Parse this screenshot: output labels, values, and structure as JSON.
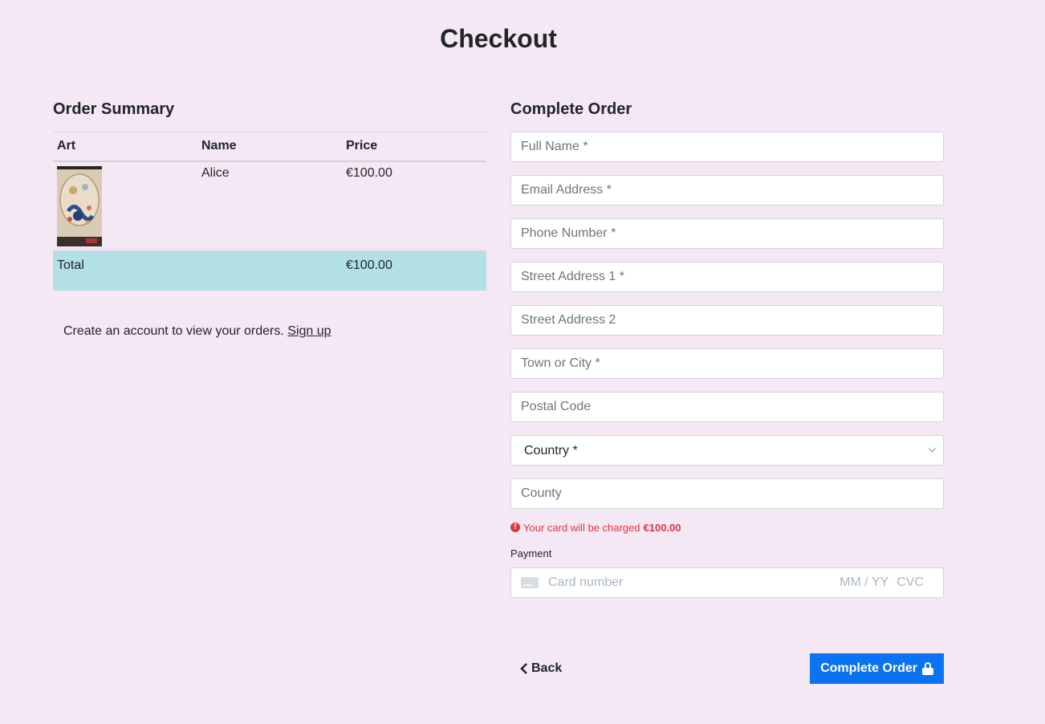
{
  "page": {
    "title": "Checkout"
  },
  "summary": {
    "heading": "Order Summary",
    "columns": {
      "art": "Art",
      "name": "Name",
      "price": "Price"
    },
    "items": [
      {
        "name": "Alice",
        "price": "€100.00"
      }
    ],
    "total_label": "Total",
    "total_value": "€100.00"
  },
  "signup": {
    "text": "Create an account to view your orders.",
    "link": "Sign up"
  },
  "form": {
    "heading": "Complete Order",
    "full_name": "Full Name *",
    "email": "Email Address *",
    "phone": "Phone Number *",
    "street1": "Street Address 1 *",
    "street2": "Street Address 2",
    "town": "Town or City *",
    "postal": "Postal Code",
    "country": "Country *",
    "county": "County"
  },
  "charge": {
    "text": "Your card will be charged",
    "amount": "€100.00"
  },
  "payment": {
    "label": "Payment",
    "card_number": "Card number",
    "expiry": "MM / YY",
    "cvc": "CVC"
  },
  "actions": {
    "back": "Back",
    "complete": "Complete Order"
  },
  "colors": {
    "background": "#f5e8f5",
    "total_row": "#b2e0e6",
    "primary": "#0a73f2",
    "error": "#dc3545"
  }
}
